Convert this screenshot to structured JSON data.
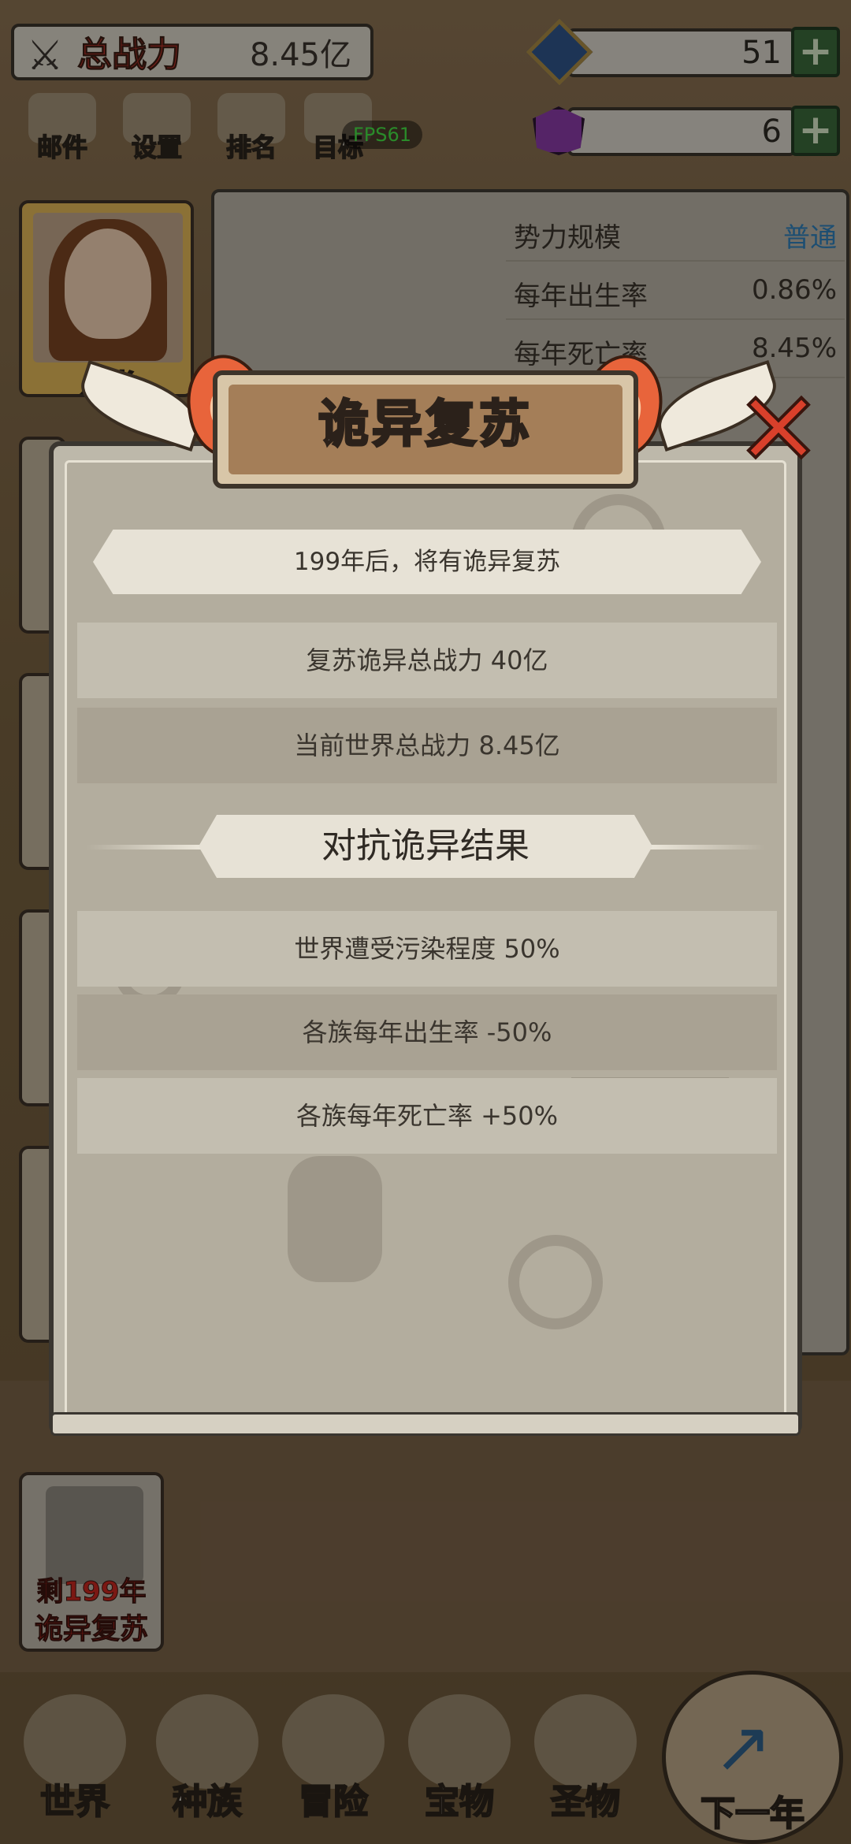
{
  "header": {
    "total_power_label": "总战力",
    "total_power_value": "8.45亿",
    "resource1_value": "51",
    "resource2_value": "6",
    "fps": "FPS61"
  },
  "menu": {
    "mail": "邮件",
    "settings": "设置",
    "rank": "排名",
    "goal": "目标"
  },
  "race_card": {
    "label": "人类"
  },
  "info_panel": {
    "rows": [
      {
        "key": "势力规模",
        "value": "普通"
      },
      {
        "key": "每年出生率",
        "value": "0.86%"
      },
      {
        "key": "每年死亡率",
        "value": "8.45%"
      }
    ]
  },
  "dialog": {
    "title": "诡异复苏",
    "banner": "199年后，将有诡异复苏",
    "row_revive_power": "复苏诡异总战力  40亿",
    "row_world_power": "当前世界总战力  8.45亿",
    "section_title": "对抗诡异结果",
    "row_pollution": "世界遭受污染程度 50%",
    "row_birth": "各族每年出生率 -50%",
    "row_death": "各族每年死亡率 +50%"
  },
  "weird_card": {
    "remaining": "剩199年",
    "label": "诡异复苏"
  },
  "nav": {
    "world": "世界",
    "race": "种族",
    "adventure": "冒险",
    "treasure": "宝物",
    "relic": "圣物",
    "next_year": "下一年"
  },
  "colors": {
    "accent_red": "#c4332a",
    "plus_green": "#3b6a3a",
    "link_blue": "#2f7fb8"
  }
}
